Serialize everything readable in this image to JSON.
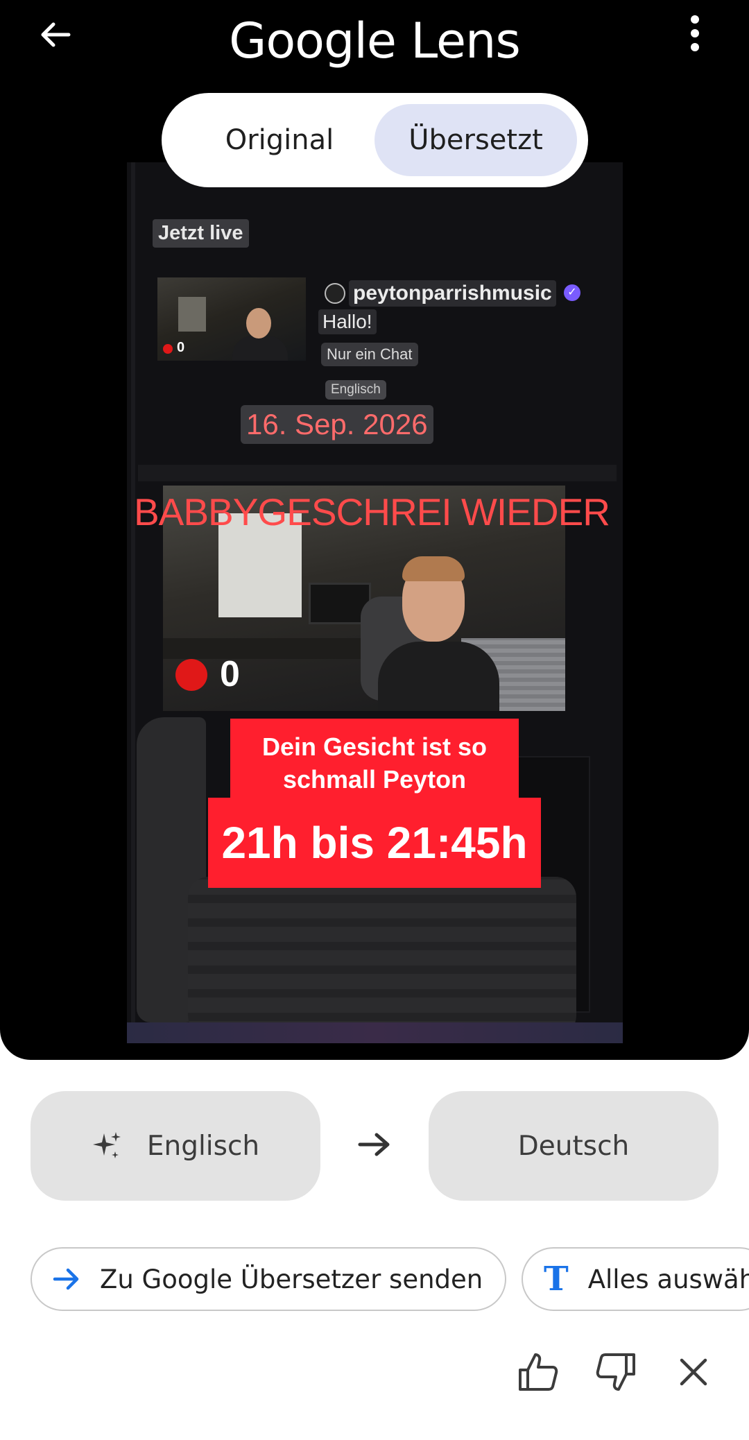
{
  "header": {
    "title": "Google Lens",
    "back_icon": "arrow-left-icon",
    "menu_icon": "more-vert-icon"
  },
  "view_toggle": {
    "original_label": "Original",
    "translated_label": "Übersetzt",
    "selected": "translated"
  },
  "image_overlay": {
    "section_label": "Jetzt live",
    "thumb_viewer_count": "0",
    "channel_name": "peytonparrishmusic",
    "greeting": "Hallo!",
    "chat_chip": "Nur ein Chat",
    "language_chip": "Englisch",
    "date": "16. Sep. 2026",
    "headline": "BABBYGESCHREI WIEDER",
    "stream_viewer_count": "0",
    "caption": "Dein Gesicht ist so schmall Peyton",
    "time_range": "21h bis 21:45h"
  },
  "languages": {
    "source": "Englisch",
    "target": "Deutsch",
    "source_icon": "sparkle-icon",
    "arrow_icon": "arrow-right-icon"
  },
  "actions": {
    "send_to_translate": "Zu Google Übersetzer senden",
    "select_all": "Alles auswählen"
  },
  "feedback": {
    "thumb_up_icon": "thumb-up-icon",
    "thumb_down_icon": "thumb-down-icon",
    "close_icon": "close-icon"
  },
  "colors": {
    "accent": "#1a73e8",
    "toggle_selected": "#dfe3f5",
    "overlay_red": "#ff1f2e",
    "date_text": "#ff6b6b"
  }
}
